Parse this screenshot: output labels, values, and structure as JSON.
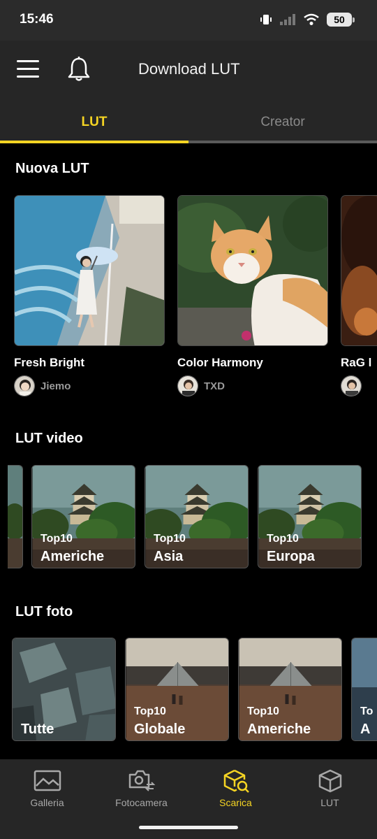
{
  "status_bar": {
    "time": "15:46",
    "battery": "50"
  },
  "header": {
    "title": "Download LUT"
  },
  "tabs": [
    {
      "label": "LUT"
    },
    {
      "label": "Creator"
    }
  ],
  "sections": {
    "new_lut": {
      "title": "Nuova LUT",
      "cards": [
        {
          "name": "Fresh Bright",
          "author": "Jiemo"
        },
        {
          "name": "Color Harmony",
          "author": "TXD"
        },
        {
          "name": "RaG l",
          "author": ""
        }
      ]
    },
    "lut_video": {
      "title": "LUT video",
      "tiles": [
        {
          "small": "Top10",
          "big": "Americhe"
        },
        {
          "small": "Top10",
          "big": "Asia"
        },
        {
          "small": "Top10",
          "big": "Europa"
        }
      ]
    },
    "lut_foto": {
      "title": "LUT foto",
      "tiles": [
        {
          "small": "",
          "big": "Tutte"
        },
        {
          "small": "Top10",
          "big": "Globale"
        },
        {
          "small": "Top10",
          "big": "Americhe"
        },
        {
          "small": "To",
          "big": "A"
        }
      ]
    }
  },
  "bottom_nav": [
    {
      "label": "Galleria",
      "icon": "gallery-icon"
    },
    {
      "label": "Fotocamera",
      "icon": "camera-switch-icon"
    },
    {
      "label": "Scarica",
      "icon": "download-search-icon",
      "active": true
    },
    {
      "label": "LUT",
      "icon": "cube-icon"
    }
  ],
  "colors": {
    "accent": "#f5d423",
    "background": "#000000",
    "panel": "#262626"
  }
}
